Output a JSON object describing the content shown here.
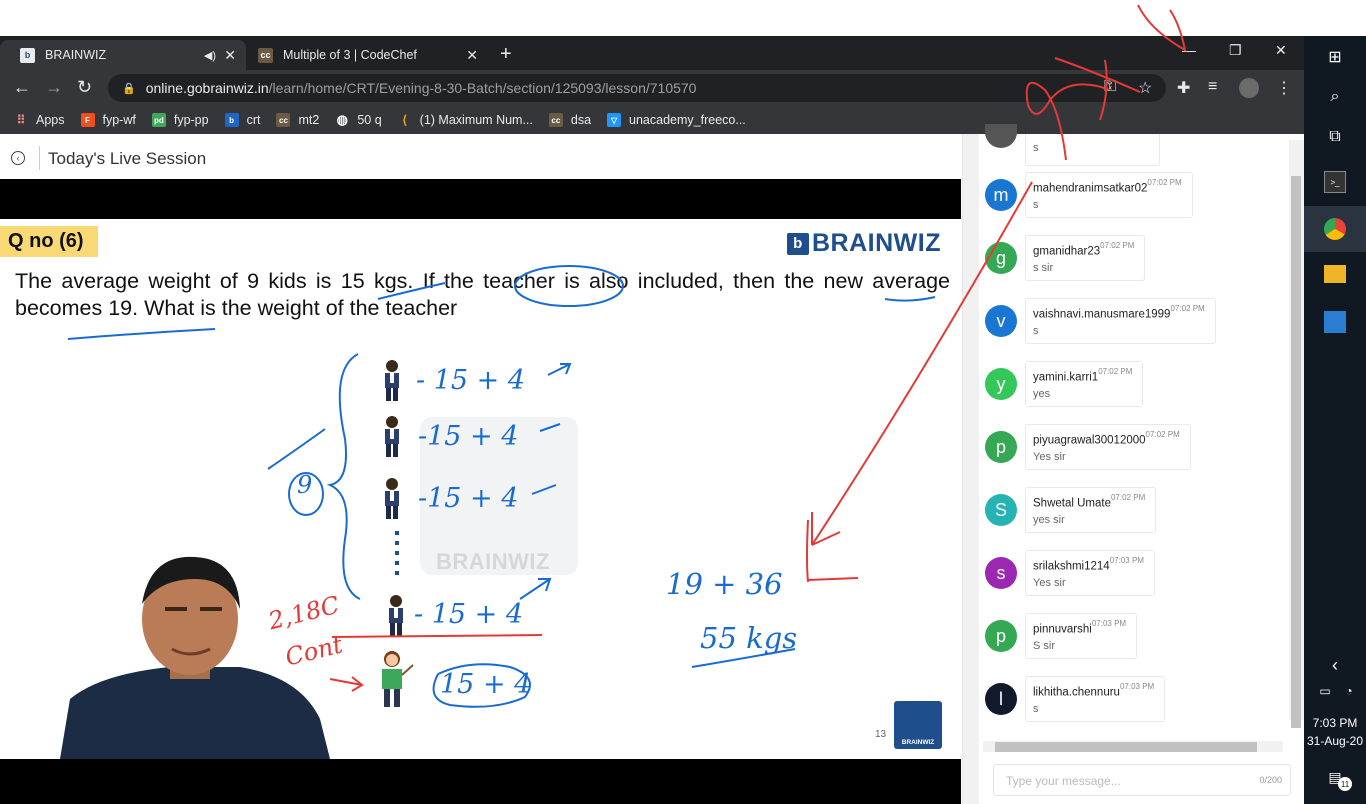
{
  "browser": {
    "tabs": [
      {
        "label": "BRAINWIZ",
        "icon": "brainwiz-favicon",
        "active": true
      },
      {
        "label": "Multiple of 3 | CodeChef",
        "icon": "codechef-favicon",
        "active": false
      }
    ],
    "url_host": "online.gobrainwiz.in",
    "url_path": "/learn/home/CRT/Evening-8-30-Batch/section/125093/lesson/710570",
    "bookmarks": [
      {
        "label": "Apps",
        "icon": "apps-grid-icon"
      },
      {
        "label": "fyp-wf",
        "icon": "figma-icon"
      },
      {
        "label": "fyp-pp",
        "icon": "pd-icon"
      },
      {
        "label": "crt",
        "icon": "brainwiz-icon"
      },
      {
        "label": "mt2",
        "icon": "codechef-icon"
      },
      {
        "label": "50 q",
        "icon": "globe-icon"
      },
      {
        "label": "(1) Maximum Num...",
        "icon": "leetcode-icon"
      },
      {
        "label": "dsa",
        "icon": "codechef-icon"
      },
      {
        "label": "unacademy_freeco...",
        "icon": "unacademy-icon"
      }
    ]
  },
  "page": {
    "session_title": "Today's Live Session"
  },
  "slide": {
    "qno": "Q no (6)",
    "brand": "BRAINWIZ",
    "question": "The average weight of 9 kids is 15 kgs. If the teacher is also included, then the new average becomes 19. What is the weight of the teacher",
    "rows": [
      "- 15 + 4",
      "-15 + 4",
      "-15 + 4",
      "- 15 + 4"
    ],
    "teacher_row": "15 + 4",
    "count": "9",
    "calc1": "19  + 36",
    "calc2": "55 kgs",
    "hand_note1": "2,18C",
    "hand_note2": "Cont",
    "watermark": "BRAINWIZ",
    "slide_number": "13",
    "logo_text": "BRAINWIZ"
  },
  "chat": {
    "messages": [
      {
        "initial": "m",
        "color": "#1976d2",
        "user": "mahendranimsatkar02",
        "time": "07:02 PM",
        "text": "s"
      },
      {
        "initial": "g",
        "color": "#34a853",
        "user": "gmanidhar23",
        "time": "07:02 PM",
        "text": "s sir"
      },
      {
        "initial": "v",
        "color": "#1976d2",
        "user": "vaishnavi.manusmare1999",
        "time": "07:02 PM",
        "text": "s"
      },
      {
        "initial": "y",
        "color": "#34c759",
        "user": "yamini.karri1",
        "time": "07:02 PM",
        "text": "yes"
      },
      {
        "initial": "p",
        "color": "#34a853",
        "user": "piyuagrawal30012000",
        "time": "07:02 PM",
        "text": "Yes sir"
      },
      {
        "initial": "S",
        "color": "#26b3b3",
        "user": "Shwetal Umate",
        "time": "07:02 PM",
        "text": "yes sir"
      },
      {
        "initial": "s",
        "color": "#9c27b0",
        "user": "srilakshmi1214",
        "time": "07:03 PM",
        "text": "Yes sir"
      },
      {
        "initial": "p",
        "color": "#34a853",
        "user": "pinnuvarshi",
        "time": "07:03 PM",
        "text": "S sir"
      },
      {
        "initial": "l",
        "color": "#111a2b",
        "user": "likhitha.chennuru",
        "time": "07:03 PM",
        "text": "s"
      }
    ],
    "partial_text": "s",
    "input_placeholder": "Type your message...",
    "char_count": "0/200"
  },
  "taskbar": {
    "time": "7:03 PM",
    "date": "31-Aug-20",
    "notification_count": "11"
  }
}
